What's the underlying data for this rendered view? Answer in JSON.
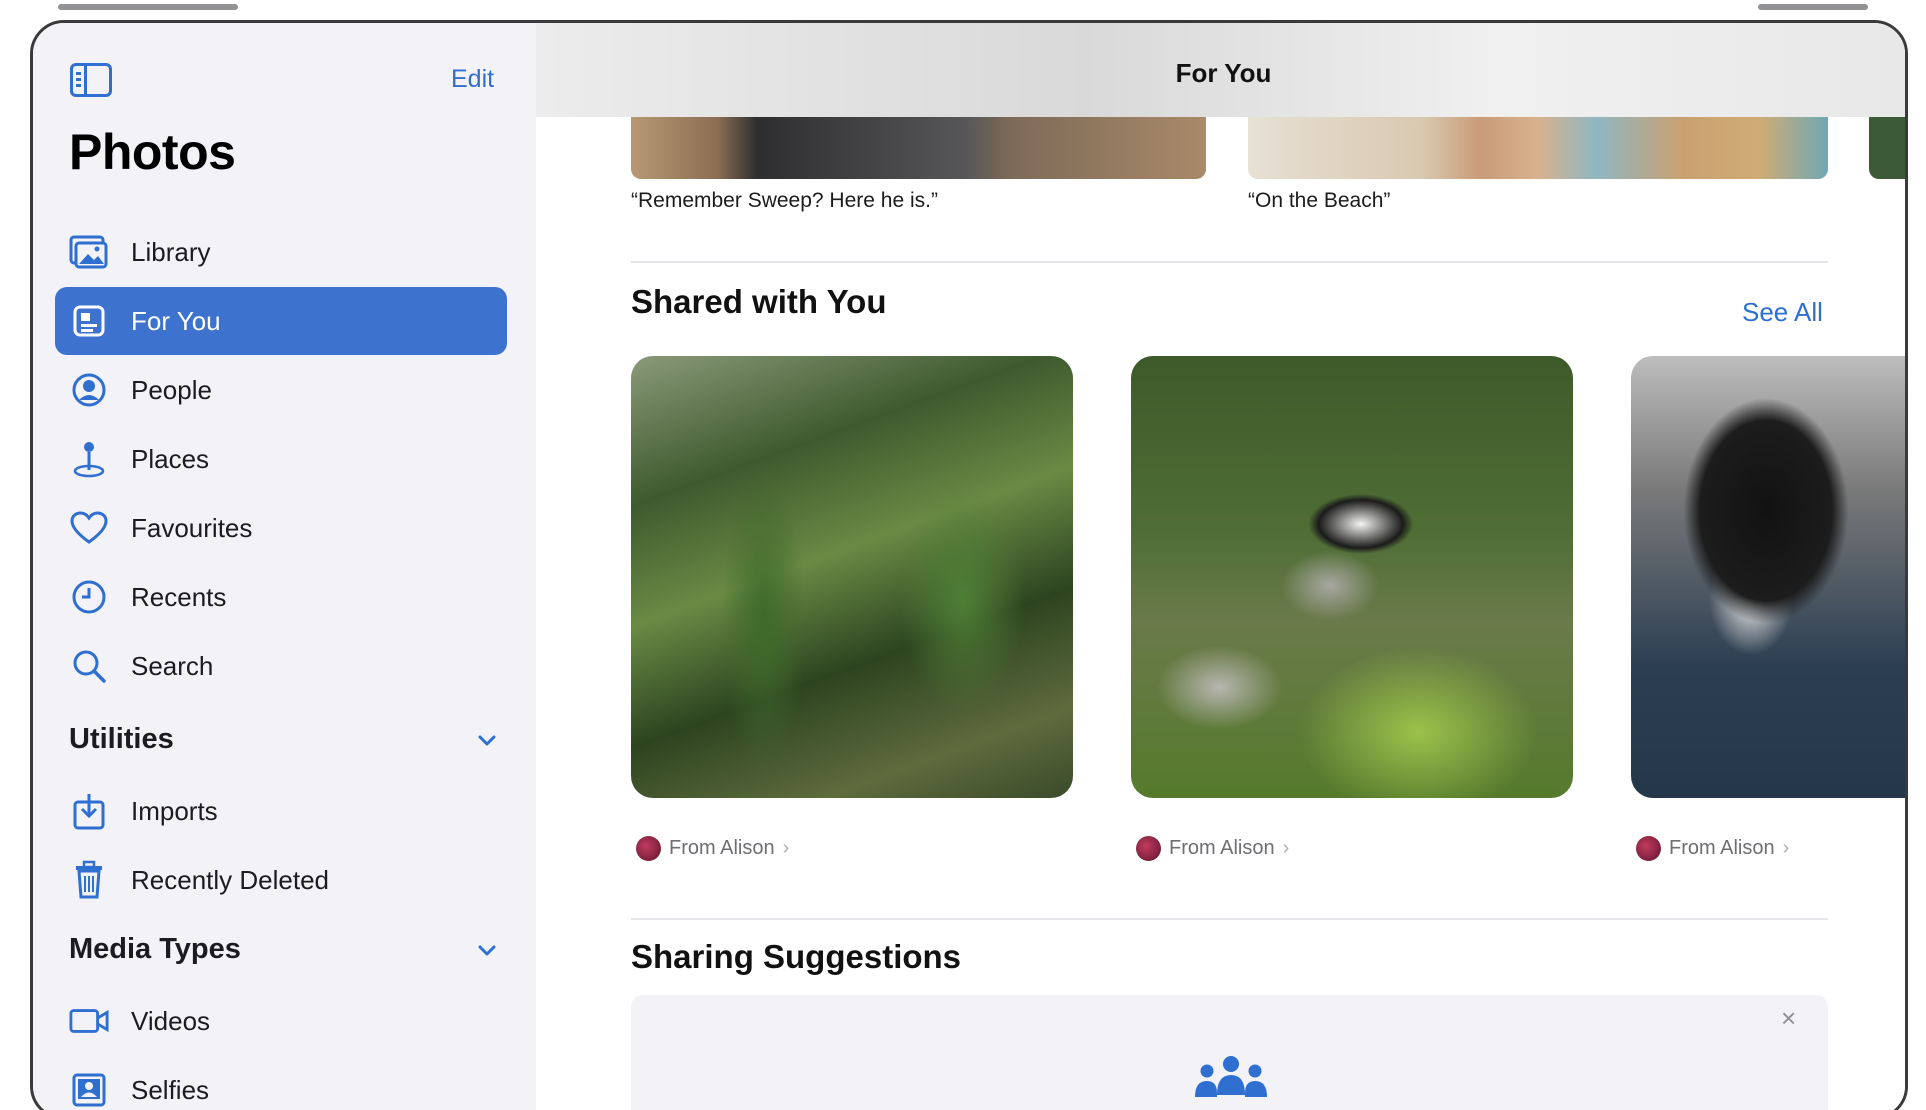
{
  "sidebar": {
    "edit_label": "Edit",
    "title": "Photos",
    "items": [
      {
        "label": "Library",
        "icon": "library-icon"
      },
      {
        "label": "For You",
        "icon": "for-you-icon",
        "selected": true
      },
      {
        "label": "People",
        "icon": "people-icon"
      },
      {
        "label": "Places",
        "icon": "places-icon"
      },
      {
        "label": "Favourites",
        "icon": "heart-icon"
      },
      {
        "label": "Recents",
        "icon": "clock-icon"
      },
      {
        "label": "Search",
        "icon": "search-icon"
      }
    ],
    "utilities": {
      "heading": "Utilities",
      "items": [
        {
          "label": "Imports",
          "icon": "imports-icon"
        },
        {
          "label": "Recently Deleted",
          "icon": "trash-icon"
        }
      ]
    },
    "media_types": {
      "heading": "Media Types",
      "items": [
        {
          "label": "Videos",
          "icon": "video-icon"
        },
        {
          "label": "Selfies",
          "icon": "selfie-icon"
        }
      ]
    }
  },
  "main": {
    "title": "For You",
    "memories": [
      {
        "caption": "“Remember Sweep? Here he is.”"
      },
      {
        "caption": "“On the Beach”"
      }
    ],
    "shared": {
      "heading": "Shared with You",
      "see_all": "See All",
      "items": [
        {
          "from": "From Alison"
        },
        {
          "from": "From Alison"
        },
        {
          "from": "From Alison"
        }
      ]
    },
    "suggestions": {
      "heading": "Sharing Suggestions",
      "close": "×"
    }
  },
  "colors": {
    "accent": "#2f6fd0",
    "selected_row": "#3d72cf",
    "sidebar_bg": "#f2f2f7"
  }
}
